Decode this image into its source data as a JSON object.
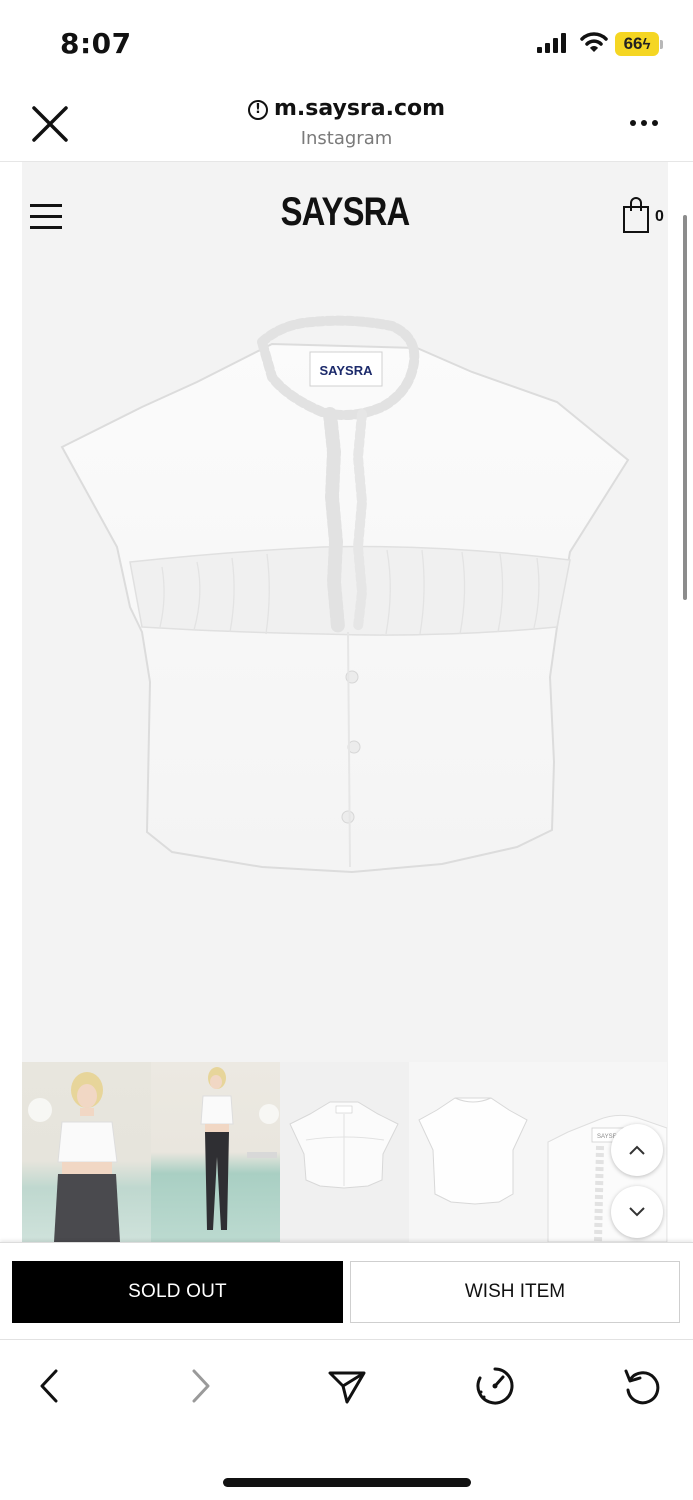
{
  "status_bar": {
    "time": "8:07",
    "battery": "66",
    "icons": [
      "cellular-signal-icon",
      "wifi-icon",
      "battery-charging-icon"
    ]
  },
  "browser": {
    "url": "m.saysra.com",
    "source": "Instagram",
    "icons": [
      "close-icon",
      "info-icon",
      "more-icon"
    ]
  },
  "site": {
    "brand": "SAYSRA",
    "cart_count": "0",
    "garment_label": "SAYSRA",
    "thumb_label": "SAYSRA",
    "icons": [
      "hamburger-menu-icon",
      "shopping-bag-icon",
      "chevron-up-icon",
      "chevron-down-icon"
    ]
  },
  "product": {
    "sold_out_label": "SOLD OUT",
    "wish_label": "WISH ITEM"
  },
  "toolbar": {
    "icons": [
      "back-arrow-icon",
      "forward-arrow-icon",
      "share-icon",
      "speed-icon",
      "reload-icon"
    ]
  },
  "colors": {
    "page_bg": "#f3f3f3",
    "primary_button": "#000000",
    "battery": "#f5d623",
    "text_muted": "#7a7a7a"
  }
}
